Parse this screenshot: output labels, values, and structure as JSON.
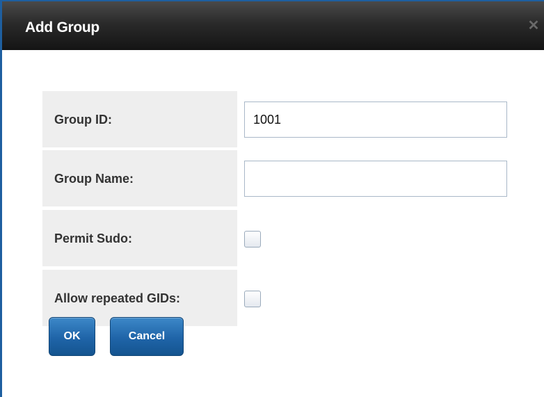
{
  "dialog": {
    "title": "Add Group",
    "close_icon": "close-icon"
  },
  "form": {
    "group_id": {
      "label": "Group ID:",
      "value": "1001"
    },
    "group_name": {
      "label": "Group Name:",
      "value": ""
    },
    "permit_sudo": {
      "label": "Permit Sudo:",
      "checked": false
    },
    "allow_repeated_gids": {
      "label": "Allow repeated GIDs:",
      "checked": false
    }
  },
  "buttons": {
    "ok_label": "OK",
    "cancel_label": "Cancel"
  },
  "colors": {
    "accent_border": "#1e5fa0",
    "button_blue": "#1f64a8",
    "label_background": "#eeeeee"
  }
}
